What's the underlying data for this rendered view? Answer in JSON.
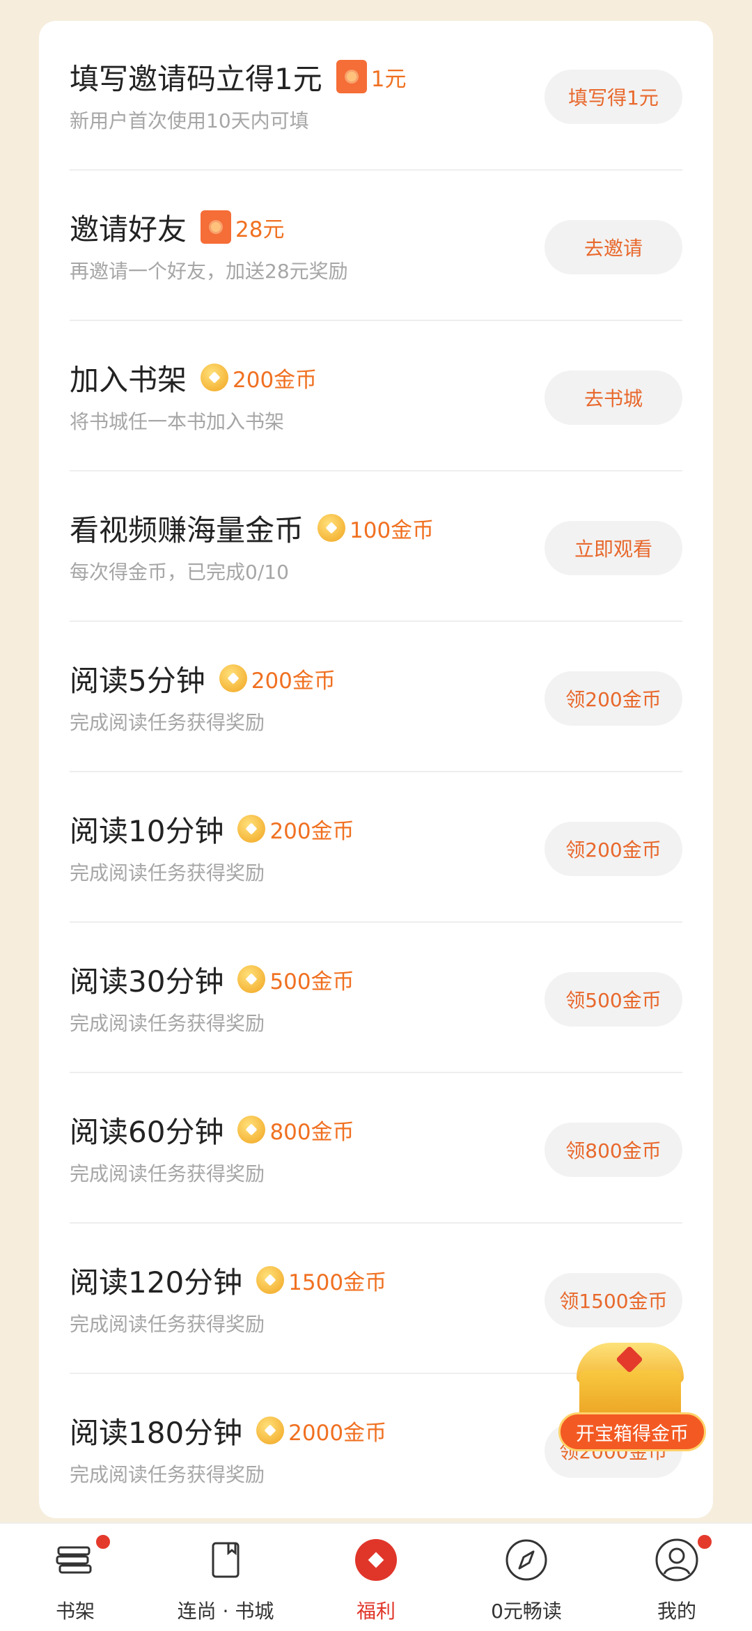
{
  "tasks": [
    {
      "title": "填写邀请码立得1元",
      "reward": "1元",
      "reward_type": "redpacket-icon",
      "subtitle": "新用户首次使用10天内可填",
      "button": "填写得1元"
    },
    {
      "title": "邀请好友",
      "reward": "28元",
      "reward_type": "redpacket-icon",
      "subtitle": "再邀请一个好友，加送28元奖励",
      "button": "去邀请"
    },
    {
      "title": "加入书架",
      "reward": "200金币",
      "reward_type": "coin-icon",
      "subtitle": "将书城任一本书加入书架",
      "button": "去书城"
    },
    {
      "title": "看视频赚海量金币",
      "reward": "100金币",
      "reward_type": "coin-icon",
      "subtitle": "每次得金币，已完成0/10",
      "button": "立即观看"
    },
    {
      "title": "阅读5分钟",
      "reward": "200金币",
      "reward_type": "coin-icon",
      "subtitle": "完成阅读任务获得奖励",
      "button": "领200金币"
    },
    {
      "title": "阅读10分钟",
      "reward": "200金币",
      "reward_type": "coin-icon",
      "subtitle": "完成阅读任务获得奖励",
      "button": "领200金币"
    },
    {
      "title": "阅读30分钟",
      "reward": "500金币",
      "reward_type": "coin-icon",
      "subtitle": "完成阅读任务获得奖励",
      "button": "领500金币"
    },
    {
      "title": "阅读60分钟",
      "reward": "800金币",
      "reward_type": "coin-icon",
      "subtitle": "完成阅读任务获得奖励",
      "button": "领800金币"
    },
    {
      "title": "阅读120分钟",
      "reward": "1500金币",
      "reward_type": "coin-icon",
      "subtitle": "完成阅读任务获得奖励",
      "button": "领1500金币"
    },
    {
      "title": "阅读180分钟",
      "reward": "2000金币",
      "reward_type": "coin-icon",
      "subtitle": "完成阅读任务获得奖励",
      "button": "领2000金币"
    }
  ],
  "floating": {
    "label": "开宝箱得金币",
    "icon": "treasure-chest-icon"
  },
  "nav": [
    {
      "label": "书架",
      "icon": "bookshelf-icon",
      "badge": true,
      "active": false
    },
    {
      "label": "连尚 · 书城",
      "icon": "book-icon",
      "badge": false,
      "active": false
    },
    {
      "label": "福利",
      "icon": "welfare-icon",
      "badge": false,
      "active": true
    },
    {
      "label": "0元畅读",
      "icon": "compass-icon",
      "badge": false,
      "active": false
    },
    {
      "label": "我的",
      "icon": "profile-icon",
      "badge": true,
      "active": false
    }
  ],
  "colors": {
    "accent": "#f07021",
    "active_nav": "#e0362a",
    "background": "#f6eddc"
  }
}
